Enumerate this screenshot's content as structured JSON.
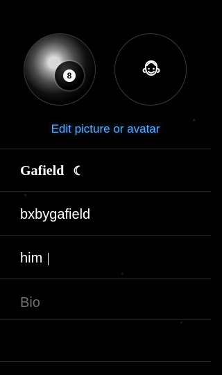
{
  "profile": {
    "edit_text": "Edit picture or avatar",
    "name": "Gafield",
    "username": "bxbygafield",
    "pronouns": "him",
    "bio_placeholder": "Bio"
  },
  "icons": {
    "photo_avatar": "billiard-ball-icon",
    "memoji_avatar": "memoji-face-icon",
    "name_badge": "crescent-moon-icon"
  },
  "colors": {
    "background": "#000000",
    "accent": "#5aa9ff",
    "text": "#ffffff",
    "placeholder": "#6f6f6f",
    "divider": "#2a2a2a"
  }
}
